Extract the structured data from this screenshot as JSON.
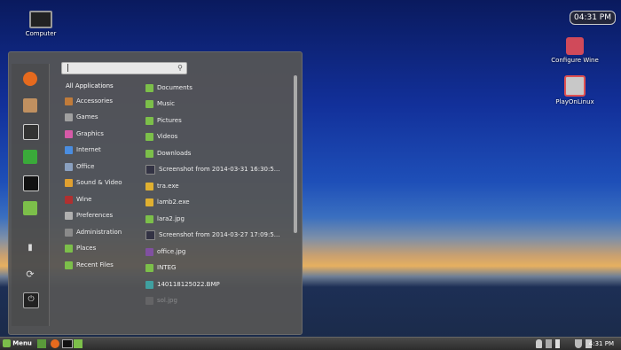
{
  "desktop": {
    "icons": [
      {
        "label": "Computer"
      },
      {
        "label": "Configure Wine"
      },
      {
        "label": "PlayOnLinux"
      }
    ],
    "clock": "04:31 PM"
  },
  "menu": {
    "search": {
      "placeholder": ""
    },
    "categories": [
      {
        "label": "All Applications",
        "icon": "none",
        "color": "transparent"
      },
      {
        "label": "Accessories",
        "icon": "accessories-icon",
        "color": "#c07b3a"
      },
      {
        "label": "Games",
        "icon": "games-icon",
        "color": "#a0a0a0"
      },
      {
        "label": "Graphics",
        "icon": "graphics-icon",
        "color": "#d65aa8"
      },
      {
        "label": "Internet",
        "icon": "internet-icon",
        "color": "#4a8de0"
      },
      {
        "label": "Office",
        "icon": "office-icon",
        "color": "#8aa0c0"
      },
      {
        "label": "Sound & Video",
        "icon": "sound-video-icon",
        "color": "#e0a030"
      },
      {
        "label": "Wine",
        "icon": "wine-icon",
        "color": "#b03030"
      },
      {
        "label": "Preferences",
        "icon": "preferences-icon",
        "color": "#b0b0b0"
      },
      {
        "label": "Administration",
        "icon": "administration-icon",
        "color": "#8a8a8a"
      },
      {
        "label": "Places",
        "icon": "folder-icon",
        "color": "#7cbf4a"
      },
      {
        "label": "Recent Files",
        "icon": "folder-icon",
        "color": "#7cbf4a"
      }
    ],
    "files": [
      {
        "label": "Documents",
        "icon": "folder-icon",
        "color": "#7cbf4a"
      },
      {
        "label": "Music",
        "icon": "folder-icon",
        "color": "#7cbf4a"
      },
      {
        "label": "Pictures",
        "icon": "folder-icon",
        "color": "#7cbf4a"
      },
      {
        "label": "Videos",
        "icon": "folder-icon",
        "color": "#7cbf4a"
      },
      {
        "label": "Downloads",
        "icon": "folder-icon",
        "color": "#7cbf4a"
      },
      {
        "label": "Screenshot from 2014-03-31 16:30:5...",
        "icon": "image-icon",
        "color": "#334"
      },
      {
        "label": "tra.exe",
        "icon": "exe-icon",
        "color": "#e0b030"
      },
      {
        "label": "lamb2.exe",
        "icon": "exe-icon",
        "color": "#e0b030"
      },
      {
        "label": "lara2.jpg",
        "icon": "image-icon",
        "color": "#7cbf4a"
      },
      {
        "label": "Screenshot from 2014-03-27 17:09:5...",
        "icon": "image-icon",
        "color": "#334"
      },
      {
        "label": "office.jpg",
        "icon": "image-icon",
        "color": "#8050a0"
      },
      {
        "label": "INTEG",
        "icon": "folder-icon",
        "color": "#7cbf4a"
      },
      {
        "label": "140118125022.BMP",
        "icon": "image-icon",
        "color": "#40a0a0"
      },
      {
        "label": "sol.jpg",
        "icon": "image-icon",
        "color": "#888"
      }
    ],
    "favorites": [
      {
        "name": "firefox-icon",
        "color": "#e66a1e"
      },
      {
        "name": "package-icon",
        "color": "#c09060"
      },
      {
        "name": "home-folder-icon",
        "color": "#444"
      },
      {
        "name": "terminal-green-icon",
        "color": "#3aaa3a"
      },
      {
        "name": "terminal-icon",
        "color": "#222"
      },
      {
        "name": "files-folder-icon",
        "color": "#7cbf4a"
      }
    ]
  },
  "taskbar": {
    "menu_label": "Menu",
    "time": "4:31 PM"
  }
}
